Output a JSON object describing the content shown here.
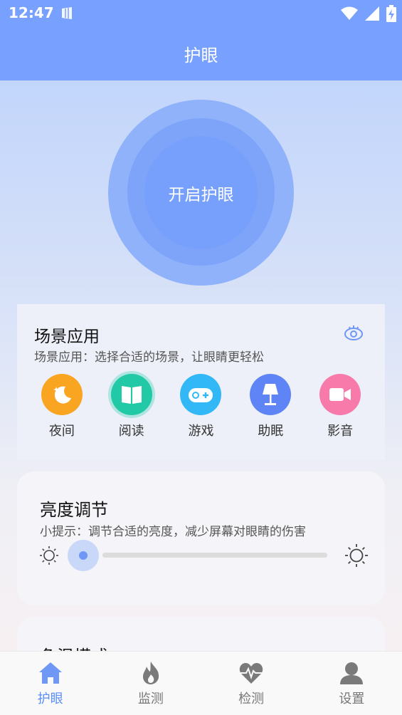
{
  "status_bar": {
    "time": "12:47"
  },
  "appbar": {
    "title": "护眼"
  },
  "main_button": {
    "label": "开启护眼"
  },
  "scene": {
    "title": "场景应用",
    "subtitle": "场景应用：选择合适的场景，让眼睛更轻松",
    "items": [
      {
        "label": "夜间",
        "icon": "moon-icon",
        "color": "#f9a521"
      },
      {
        "label": "阅读",
        "icon": "book-icon",
        "color": "#22c9a7"
      },
      {
        "label": "游戏",
        "icon": "gamepad-icon",
        "color": "#33b8f7"
      },
      {
        "label": "助眠",
        "icon": "lamp-icon",
        "color": "#5f84f5"
      },
      {
        "label": "影音",
        "icon": "video-icon",
        "color": "#f77aaa"
      }
    ]
  },
  "brightness": {
    "title": "亮度调节",
    "tip": "小提示：调节合适的亮度，减少屏幕对眼睛的伤害",
    "level": 0
  },
  "color_mode": {
    "title": "色温模式"
  },
  "bottom_nav": [
    {
      "label": "护眼",
      "icon": "home-icon",
      "active": true
    },
    {
      "label": "监测",
      "icon": "fire-icon",
      "active": false
    },
    {
      "label": "检测",
      "icon": "heart-pulse-icon",
      "active": false
    },
    {
      "label": "设置",
      "icon": "user-icon",
      "active": false
    }
  ],
  "colors": {
    "primary": "#78a1ff",
    "active_nav": "#5b8ef9"
  }
}
